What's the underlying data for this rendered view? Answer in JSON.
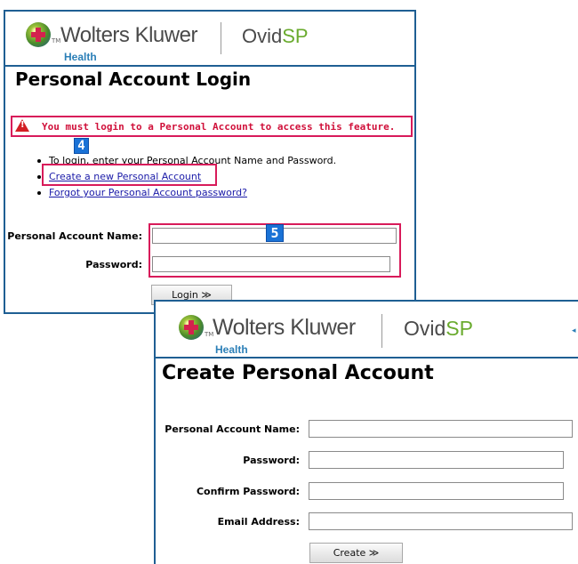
{
  "login_window": {
    "brand": {
      "company": "Wolters Kluwer",
      "division": "Health",
      "product_prefix": "Ovid",
      "product_suffix": "SP",
      "trademark": "TM"
    },
    "title": "Personal Account Login",
    "warning_text": "You must login to a Personal Account to access this feature.",
    "instructions": "To login, enter your Personal Account Name and Password.",
    "links": {
      "create": "Create a new Personal Account",
      "forgot": "Forgot your Personal Account password?"
    },
    "form": {
      "account_name_label": "Personal Account Name:",
      "password_label": "Password:",
      "account_name_value": "",
      "password_value": "",
      "login_button": "Login ≫"
    }
  },
  "annotations": {
    "marker_4": "4",
    "marker_5": "5"
  },
  "create_window": {
    "brand": {
      "company": "Wolters Kluwer",
      "division": "Health",
      "product_prefix": "Ovid",
      "product_suffix": "SP",
      "trademark": "TM"
    },
    "title": "Create Personal Account",
    "form": {
      "account_name_label": "Personal Account Name:",
      "password_label": "Password:",
      "confirm_password_label": "Confirm Password:",
      "email_label": "Email Address:",
      "account_name_value": "",
      "password_value": "",
      "confirm_password_value": "",
      "email_value": "",
      "create_button": "Create ≫"
    }
  },
  "colors": {
    "frame_blue": "#1f5f93",
    "highlight_pink": "#d81b5a",
    "warning_red": "#d0103a",
    "brand_blue": "#2b7fb7",
    "brand_green": "#6aab2e"
  }
}
